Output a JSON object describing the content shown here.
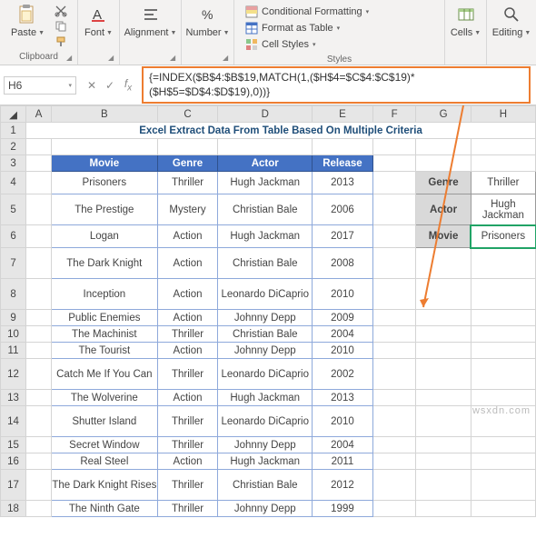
{
  "ribbon": {
    "clipboard": {
      "label": "Clipboard",
      "paste": "Paste"
    },
    "font": {
      "label": "Font",
      "btn": "Font"
    },
    "alignment": {
      "label": "Alignment",
      "btn": "Alignment"
    },
    "number": {
      "label": "Number",
      "btn": "Number"
    },
    "styles": {
      "label": "Styles",
      "conditional": "Conditional Formatting",
      "table": "Format as Table",
      "cell": "Cell Styles"
    },
    "cells": {
      "label": "Cells",
      "btn": "Cells"
    },
    "editing": {
      "label": "Editing",
      "btn": "Editing"
    }
  },
  "namebox": "H6",
  "formula": "{=INDEX($B$4:$B$19,MATCH(1,($H$4=$C$4:$C$19)*($H$5=$D$4:$D$19),0))}",
  "cols": [
    "A",
    "B",
    "C",
    "D",
    "E",
    "F",
    "G",
    "H"
  ],
  "title": "Excel Extract Data From Table Based On Multiple Criteria",
  "headers": {
    "movie": "Movie",
    "genre": "Genre",
    "actor": "Actor",
    "release": "Release"
  },
  "rows": [
    {
      "n": 4,
      "movie": "Prisoners",
      "genre": "Thriller",
      "actor": "Hugh Jackman",
      "release": "2013",
      "h": "row-h2"
    },
    {
      "n": 5,
      "movie": "The Prestige",
      "genre": "Mystery",
      "actor": "Christian Bale",
      "release": "2006",
      "h": "row-h3"
    },
    {
      "n": 6,
      "movie": "Logan",
      "genre": "Action",
      "actor": "Hugh Jackman",
      "release": "2017",
      "h": "row-h2"
    },
    {
      "n": 7,
      "movie": "The Dark Knight",
      "genre": "Action",
      "actor": "Christian Bale",
      "release": "2008",
      "h": "row-h3"
    },
    {
      "n": 8,
      "movie": "Inception",
      "genre": "Action",
      "actor": "Leonardo DiCaprio",
      "release": "2010",
      "h": "row-h3"
    },
    {
      "n": 9,
      "movie": "Public Enemies",
      "genre": "Action",
      "actor": "Johnny Depp",
      "release": "2009",
      "h": "row-h1"
    },
    {
      "n": 10,
      "movie": "The Machinist",
      "genre": "Thriller",
      "actor": "Christian Bale",
      "release": "2004",
      "h": "row-h1"
    },
    {
      "n": 11,
      "movie": "The Tourist",
      "genre": "Action",
      "actor": "Johnny Depp",
      "release": "2010",
      "h": "row-h1"
    },
    {
      "n": 12,
      "movie": "Catch Me If You Can",
      "genre": "Thriller",
      "actor": "Leonardo DiCaprio",
      "release": "2002",
      "h": "row-h3"
    },
    {
      "n": 13,
      "movie": "The Wolverine",
      "genre": "Action",
      "actor": "Hugh Jackman",
      "release": "2013",
      "h": "row-h1"
    },
    {
      "n": 14,
      "movie": "Shutter Island",
      "genre": "Thriller",
      "actor": "Leonardo DiCaprio",
      "release": "2010",
      "h": "row-h3"
    },
    {
      "n": 15,
      "movie": "Secret Window",
      "genre": "Thriller",
      "actor": "Johnny Depp",
      "release": "2004",
      "h": "row-h1"
    },
    {
      "n": 16,
      "movie": "Real Steel",
      "genre": "Action",
      "actor": "Hugh Jackman",
      "release": "2011",
      "h": "row-h1"
    },
    {
      "n": 17,
      "movie": "The Dark Knight Rises",
      "genre": "Thriller",
      "actor": "Christian Bale",
      "release": "2012",
      "h": "row-h3"
    },
    {
      "n": 18,
      "movie": "The Ninth Gate",
      "genre": "Thriller",
      "actor": "Johnny Depp",
      "release": "1999",
      "h": "row-h1"
    }
  ],
  "side": {
    "genre_l": "Genre",
    "genre_v": "Thriller",
    "actor_l": "Actor",
    "actor_v": "Hugh Jackman",
    "movie_l": "Movie",
    "movie_v": "Prisoners"
  },
  "watermark": "wsxdn.com"
}
